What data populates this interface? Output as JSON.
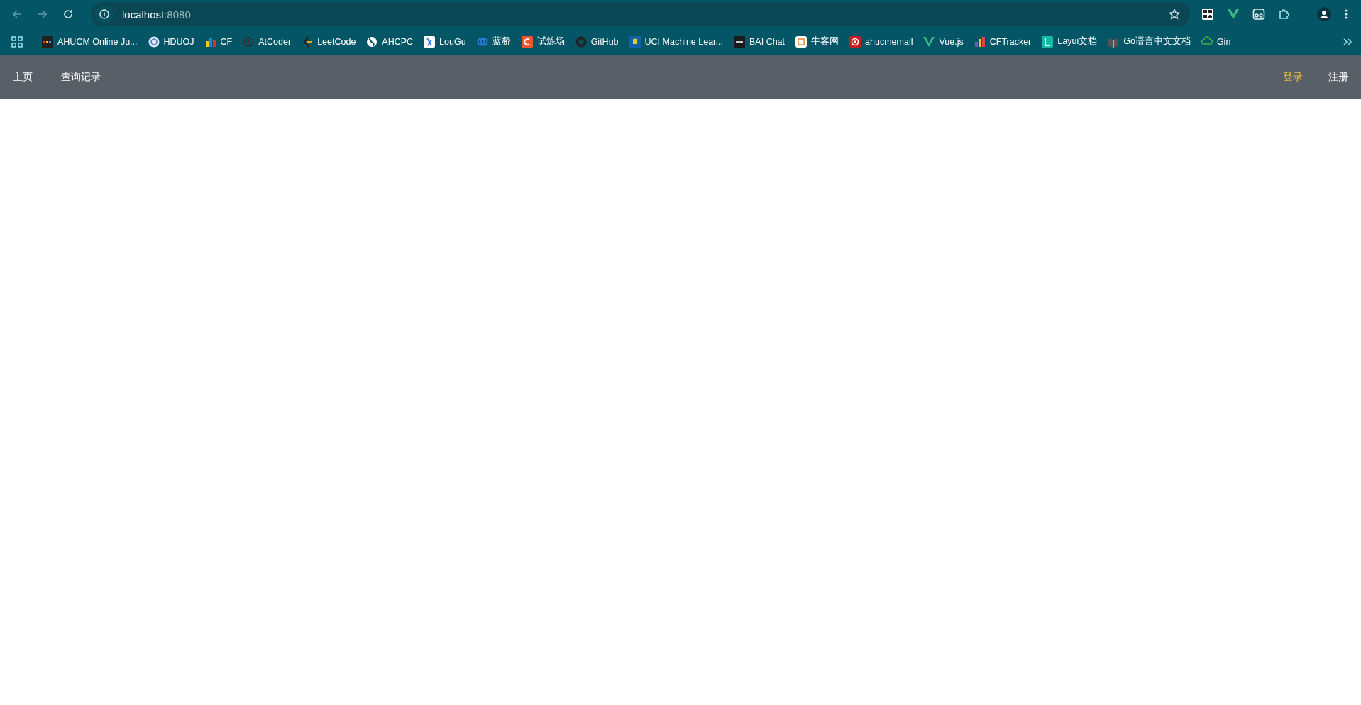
{
  "browser": {
    "address": {
      "host": "localhost",
      "port": ":8080"
    },
    "bookmarks": [
      {
        "label": "AHUCM Online Ju..."
      },
      {
        "label": "HDUOJ"
      },
      {
        "label": "CF"
      },
      {
        "label": "AtCoder"
      },
      {
        "label": "LeetCode"
      },
      {
        "label": "AHCPC"
      },
      {
        "label": "LouGu"
      },
      {
        "label": "蓝桥"
      },
      {
        "label": "试炼场"
      },
      {
        "label": "GitHub"
      },
      {
        "label": "UCI Machine Lear..."
      },
      {
        "label": "BAI Chat"
      },
      {
        "label": "牛客网"
      },
      {
        "label": "ahucmemail"
      },
      {
        "label": "Vue.js"
      },
      {
        "label": "CFTracker"
      },
      {
        "label": "Layui文档"
      },
      {
        "label": "Go语言中文文档"
      },
      {
        "label": "Gin"
      }
    ]
  },
  "navbar": {
    "left": [
      {
        "label": "主页",
        "selected": false
      },
      {
        "label": "查询记录",
        "selected": false
      }
    ],
    "right": [
      {
        "label": "登录",
        "selected": true
      },
      {
        "label": "注册",
        "selected": false
      }
    ]
  }
}
